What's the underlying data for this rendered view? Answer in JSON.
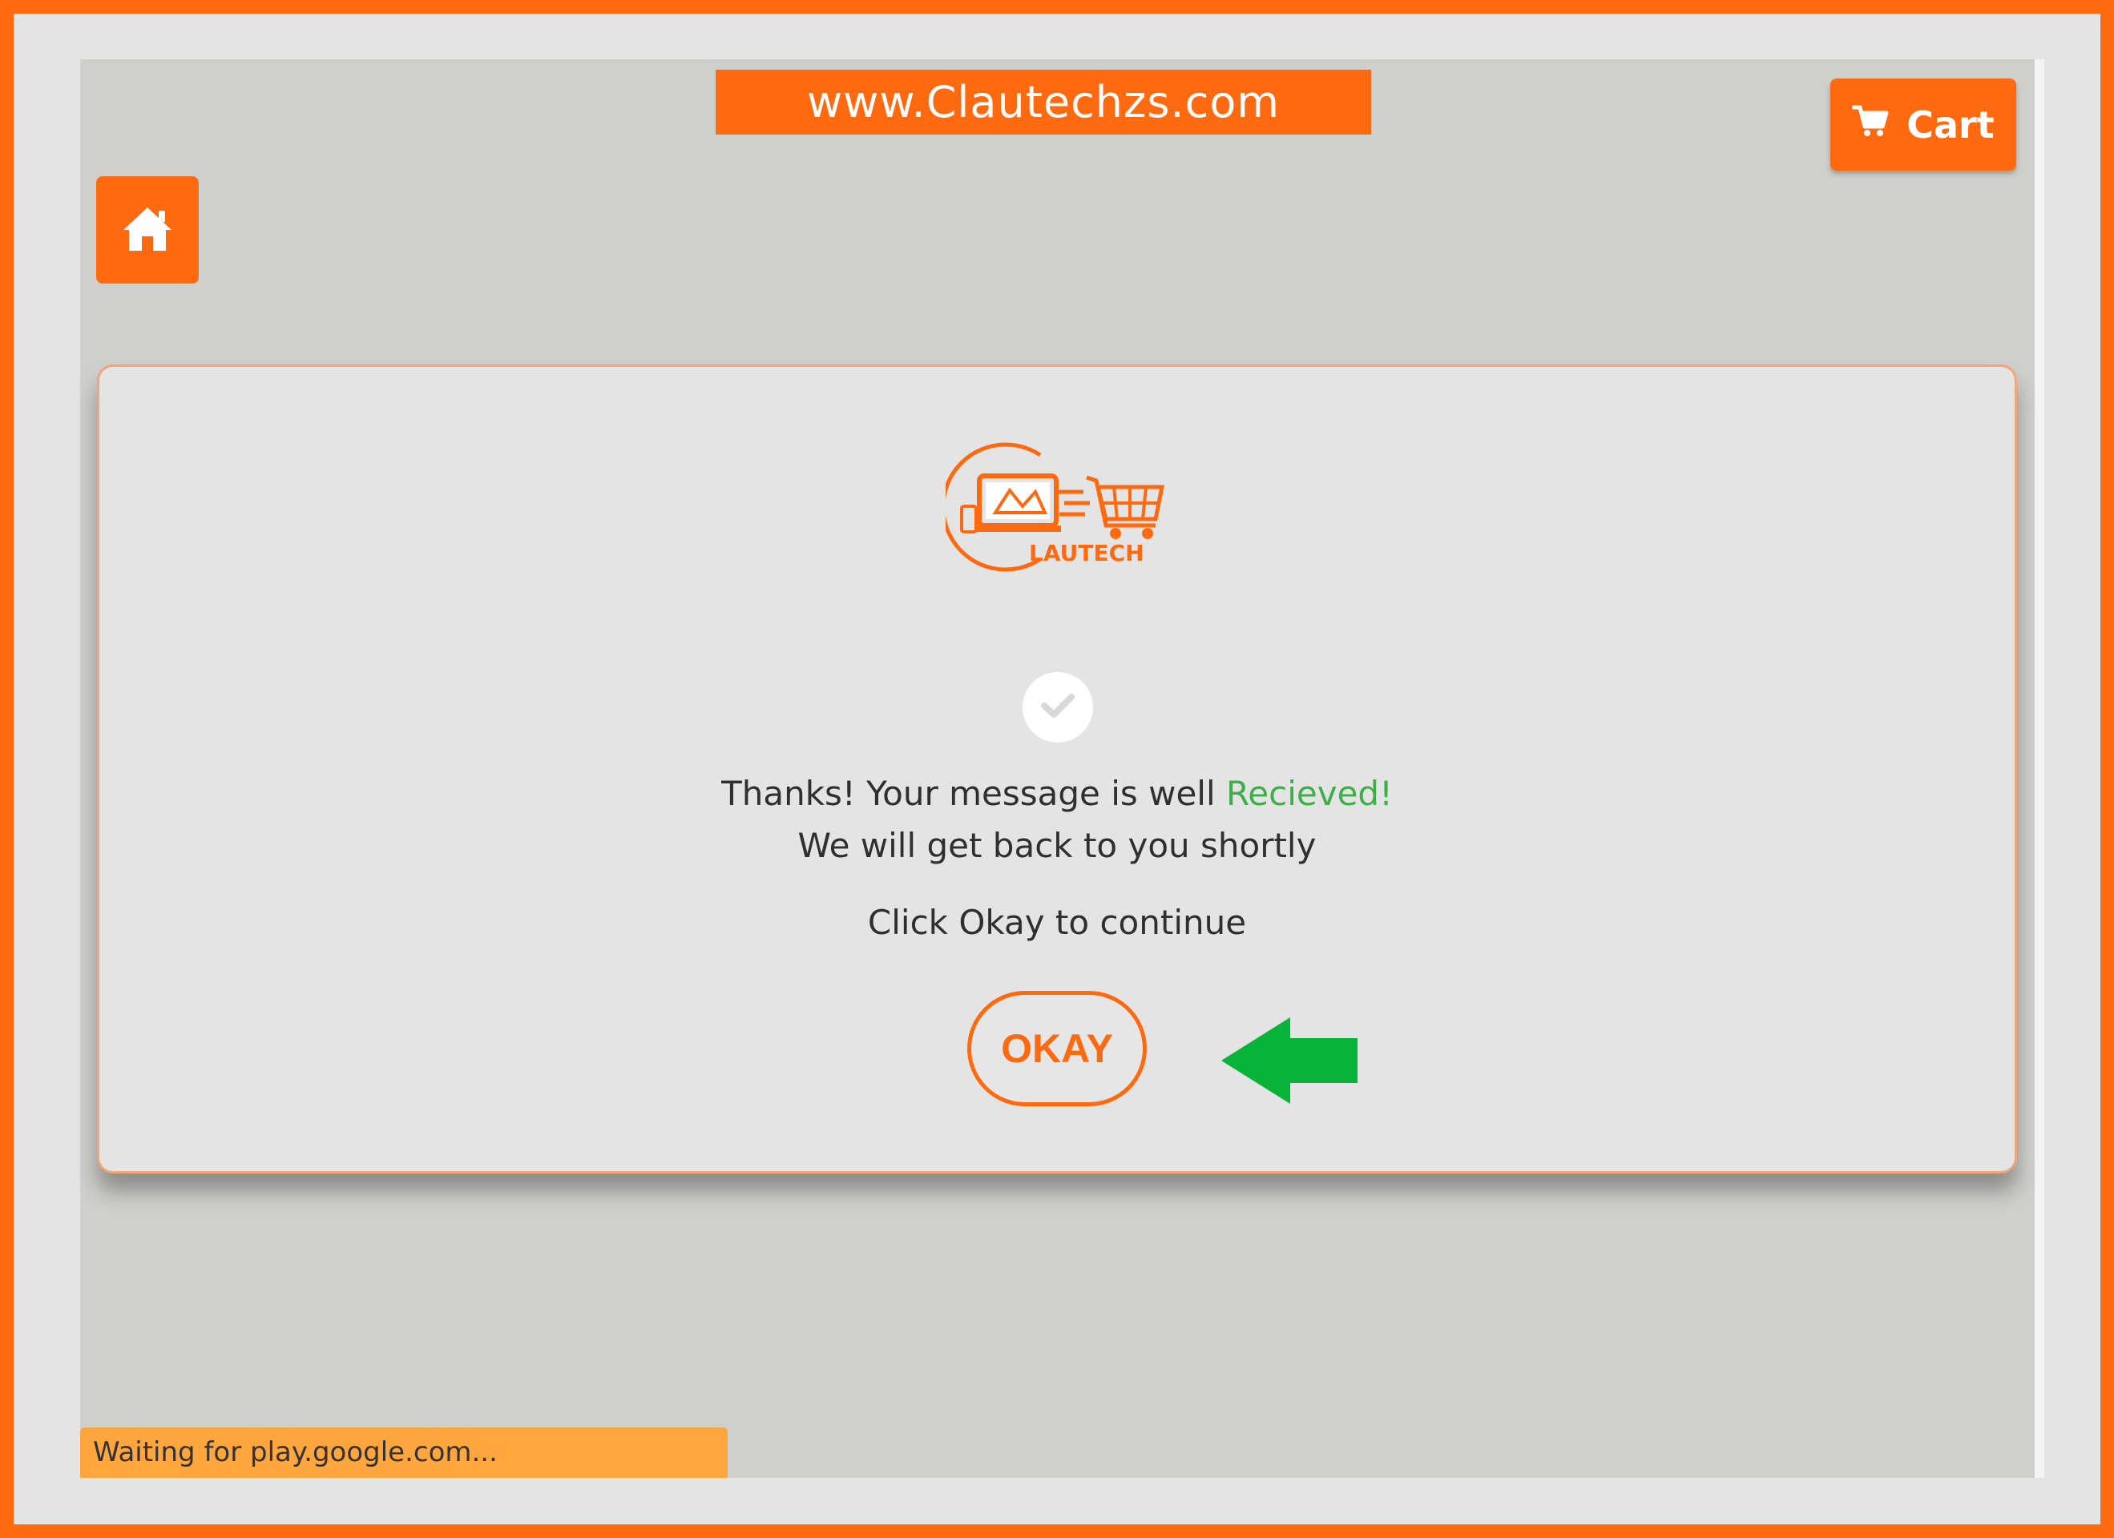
{
  "header": {
    "site_url": "www.Clautechzs.com",
    "cart_label": "Cart"
  },
  "logo": {
    "text": "LAUTECH"
  },
  "dialog": {
    "message_prefix": "Thanks! Your message is well ",
    "message_highlight": "Recieved!",
    "message_line2": "We will get back to you shortly",
    "instruction": "Click Okay to continue",
    "okay_label": "OKAY"
  },
  "status": {
    "text": "Waiting for play.google.com..."
  },
  "icons": {
    "home": "home-icon",
    "cart": "cart-icon",
    "check": "check-icon",
    "arrow": "green-arrow-left-icon"
  },
  "colors": {
    "accent": "#ff6a10",
    "success": "#3fae49",
    "arrow": "#08b339",
    "status_bar": "#ffa63f"
  }
}
